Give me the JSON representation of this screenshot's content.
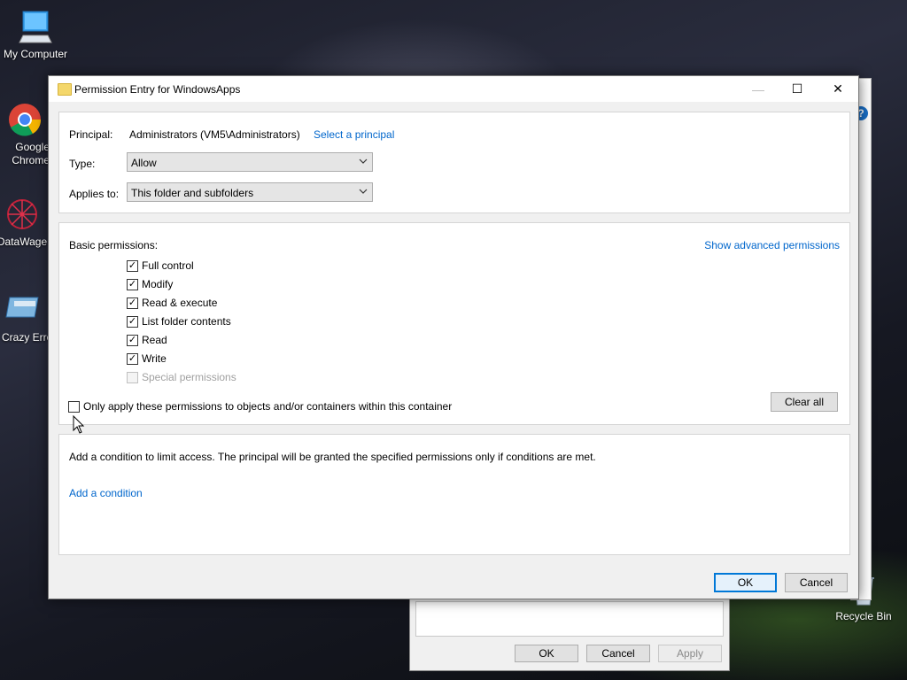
{
  "desktop": {
    "icons": [
      {
        "label": "My Computer"
      },
      {
        "label": "Google Chrome"
      },
      {
        "label": "DataWage"
      },
      {
        "label": "Crazy Erro"
      },
      {
        "label": "Recycle Bin"
      }
    ]
  },
  "background_dialog": {
    "buttons": {
      "ok": "OK",
      "cancel": "Cancel",
      "apply": "Apply"
    },
    "help_glyph": "?"
  },
  "dialog": {
    "title": "Permission Entry for WindowsApps",
    "titlebar_buttons": {
      "minimize": "—",
      "maximize": "☐",
      "close": "✕"
    },
    "principal_label": "Principal:",
    "principal_value": "Administrators (VM5\\Administrators)",
    "select_principal_link": "Select a principal",
    "type_label": "Type:",
    "type_value": "Allow",
    "applies_label": "Applies to:",
    "applies_value": "This folder and subfolders",
    "basic_permissions_label": "Basic permissions:",
    "show_advanced_link": "Show advanced permissions",
    "permissions": [
      {
        "label": "Full control",
        "checked": true,
        "disabled": false
      },
      {
        "label": "Modify",
        "checked": true,
        "disabled": false
      },
      {
        "label": "Read & execute",
        "checked": true,
        "disabled": false
      },
      {
        "label": "List folder contents",
        "checked": true,
        "disabled": false
      },
      {
        "label": "Read",
        "checked": true,
        "disabled": false
      },
      {
        "label": "Write",
        "checked": true,
        "disabled": false
      },
      {
        "label": "Special permissions",
        "checked": false,
        "disabled": true
      }
    ],
    "only_apply_label": "Only apply these permissions to objects and/or containers within this container",
    "clear_all_label": "Clear all",
    "condition_text": "Add a condition to limit access. The principal will be granted the specified permissions only if conditions are met.",
    "add_condition_link": "Add a condition",
    "ok_label": "OK",
    "cancel_label": "Cancel"
  },
  "colors": {
    "link": "#0066cc",
    "accent": "#0078d7"
  }
}
